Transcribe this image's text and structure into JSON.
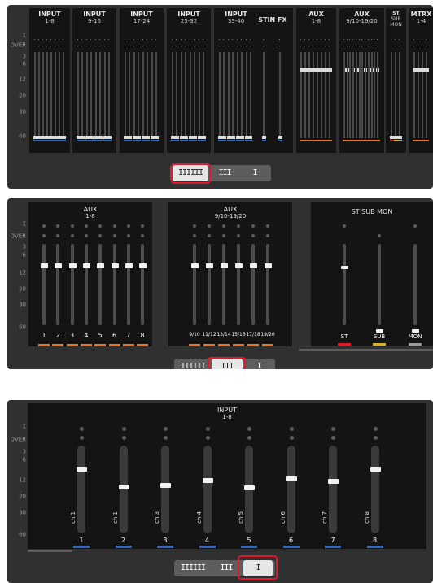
{
  "scale_labels": [
    "Σ",
    "OVER",
    "3",
    "6",
    "12",
    "20",
    "30",
    "60"
  ],
  "panel1": {
    "groups": [
      {
        "line1": "INPUT",
        "line2": "1-8"
      },
      {
        "line1": "INPUT",
        "line2": "9-16"
      },
      {
        "line1": "INPUT",
        "line2": "17-24"
      },
      {
        "line1": "INPUT",
        "line2": "25-32"
      },
      {
        "line1": "INPUT",
        "line2": "33-40"
      },
      {
        "line1": "STIN FX",
        "line2": ""
      },
      {
        "line1": "AUX",
        "line2": "1-8"
      },
      {
        "line1": "AUX",
        "line2": "9/10-19/20"
      },
      {
        "line1": "ST",
        "line2": "SUB MON"
      },
      {
        "line1": "MTRX",
        "line2": "1-4"
      }
    ],
    "selector": [
      "IIIIII",
      "III",
      "I"
    ],
    "selected": 0
  },
  "panel2": {
    "aux1": {
      "line1": "AUX",
      "line2": "1-8",
      "channels": [
        "1",
        "2",
        "3",
        "4",
        "5",
        "6",
        "7",
        "8"
      ]
    },
    "aux2": {
      "line1": "AUX",
      "line2": "9/10-19/20",
      "channels": [
        "9/10",
        "11/12",
        "13/14",
        "15/16",
        "17/18",
        "19/20"
      ]
    },
    "stsub": {
      "title": "ST SUB MON",
      "channels": [
        "ST",
        "SUB",
        "MON"
      ]
    },
    "selector": [
      "IIIIII",
      "III",
      "I"
    ],
    "selected": 1
  },
  "panel3": {
    "line1": "INPUT",
    "line2": "1-8",
    "channels": [
      {
        "name": "ch 1",
        "num": "1",
        "level": 0.76
      },
      {
        "name": "ch 1",
        "num": "2",
        "level": 0.56
      },
      {
        "name": "ch 3",
        "num": "3",
        "level": 0.57
      },
      {
        "name": "ch 4",
        "num": "4",
        "level": 0.63
      },
      {
        "name": "ch 5",
        "num": "5",
        "level": 0.55
      },
      {
        "name": "ch 6",
        "num": "6",
        "level": 0.65
      },
      {
        "name": "ch 7",
        "num": "7",
        "level": 0.62
      },
      {
        "name": "ch 8",
        "num": "8",
        "level": 0.76
      }
    ],
    "selector": [
      "IIIIII",
      "III",
      "I"
    ],
    "selected": 2
  },
  "colors": {
    "orange": "#e8722a",
    "blue": "#2d67c8",
    "red": "#e0192c",
    "yellow": "#d8b427",
    "highlight": "#e0192c"
  }
}
